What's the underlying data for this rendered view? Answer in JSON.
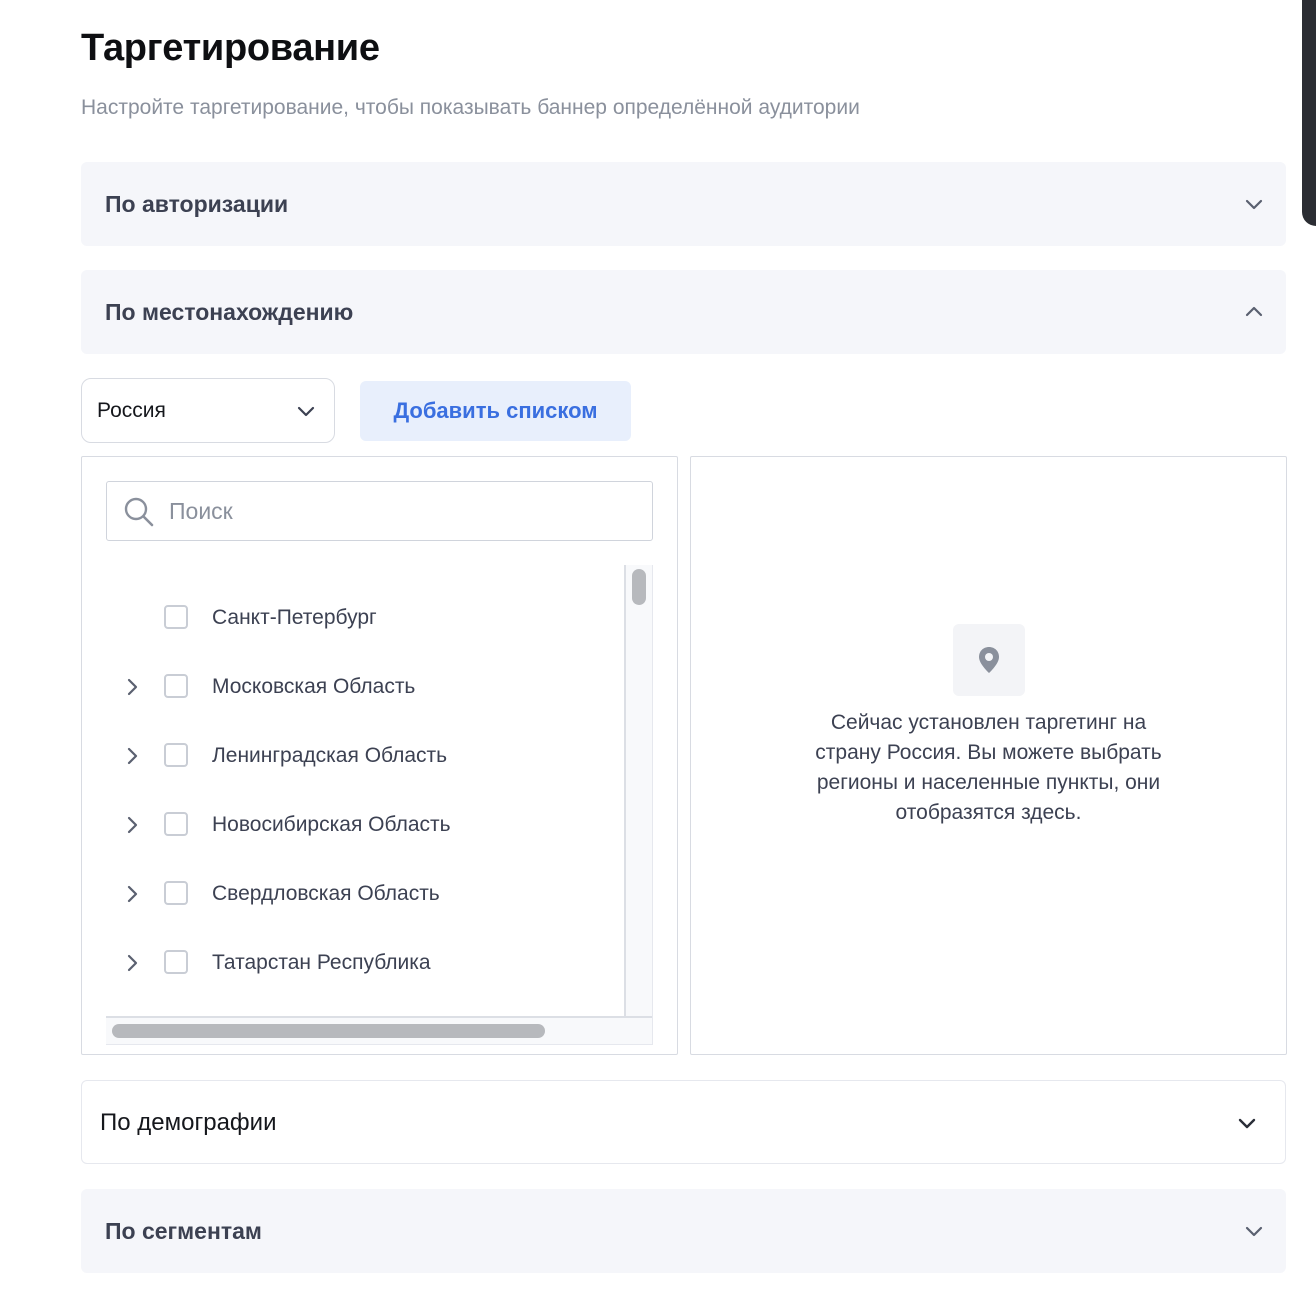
{
  "page": {
    "title": "Таргетирование",
    "subtitle": "Настройте таргетирование, чтобы показывать баннер определённой аудитории"
  },
  "sections": {
    "authorization": {
      "label": "По авторизации",
      "expanded": false
    },
    "location": {
      "label": "По местонахождению",
      "expanded": true
    },
    "demography": {
      "label": "По демографии",
      "expanded": false
    },
    "segments": {
      "label": "По сегментам",
      "expanded": false
    }
  },
  "location": {
    "country_select": {
      "value": "Россия"
    },
    "add_list_label": "Добавить списком",
    "search": {
      "placeholder": "Поиск",
      "value": ""
    },
    "regions": [
      {
        "label": "Санкт-Петербург",
        "has_children": false,
        "checked": false
      },
      {
        "label": "Московская Область",
        "has_children": true,
        "checked": false
      },
      {
        "label": "Ленинградская Область",
        "has_children": true,
        "checked": false
      },
      {
        "label": "Новосибирская Область",
        "has_children": true,
        "checked": false
      },
      {
        "label": "Свердловская Область",
        "has_children": true,
        "checked": false
      },
      {
        "label": "Татарстан Республика",
        "has_children": true,
        "checked": false
      }
    ],
    "empty_state": {
      "icon": "location-pin-icon",
      "text": "Сейчас установлен таргетинг на страну Россия. Вы можете выбрать регионы и населенные пункты, они отобразятся здесь."
    }
  },
  "colors": {
    "accent": "#3a6fe0",
    "accent_bg": "#e8effc",
    "section_bg": "#f5f6fa",
    "muted_text": "#8a909c",
    "border": "#d8dbe2"
  }
}
